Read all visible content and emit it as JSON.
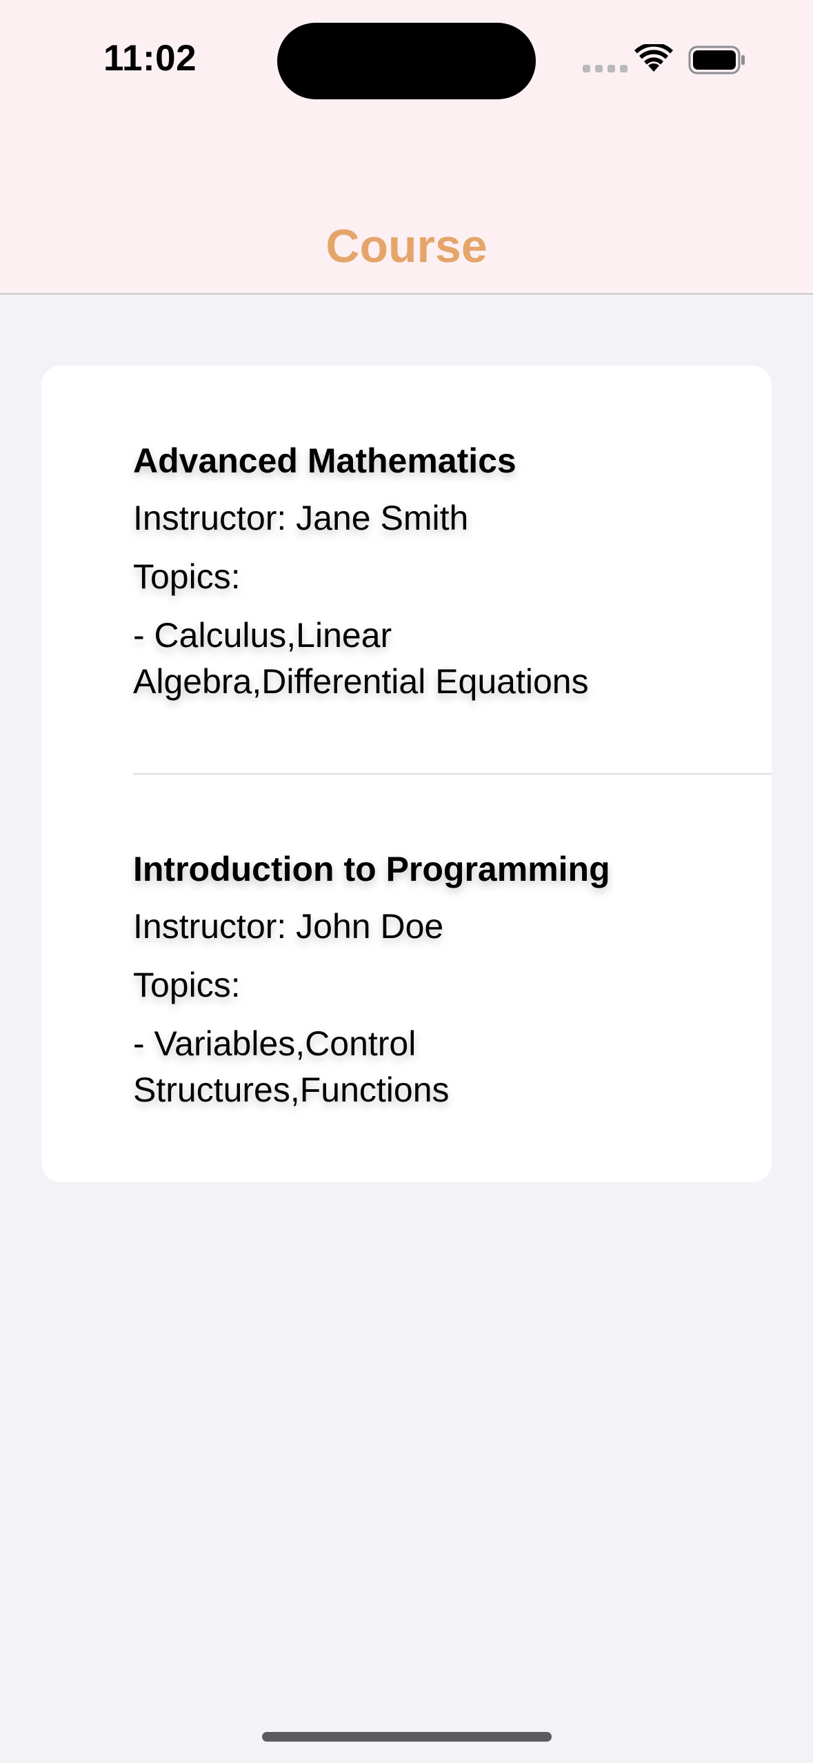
{
  "status_bar": {
    "time": "11:02"
  },
  "header": {
    "title": "Course",
    "title_color": "#e5a56a",
    "background_color": "#fcf0f2"
  },
  "courses": [
    {
      "name": "Advanced Mathematics",
      "instructor": "Instructor: Jane Smith",
      "topics_label": "Topics:",
      "topics": "- Calculus,Linear Algebra,Differential Equations"
    },
    {
      "name": "Introduction to Programming",
      "instructor": "Instructor: John Doe",
      "topics_label": "Topics:",
      "topics": "- Variables,Control Structures,Functions"
    }
  ],
  "icons": {
    "signal": "cellular-signal-icon",
    "wifi": "wifi-icon",
    "battery": "battery-icon"
  }
}
